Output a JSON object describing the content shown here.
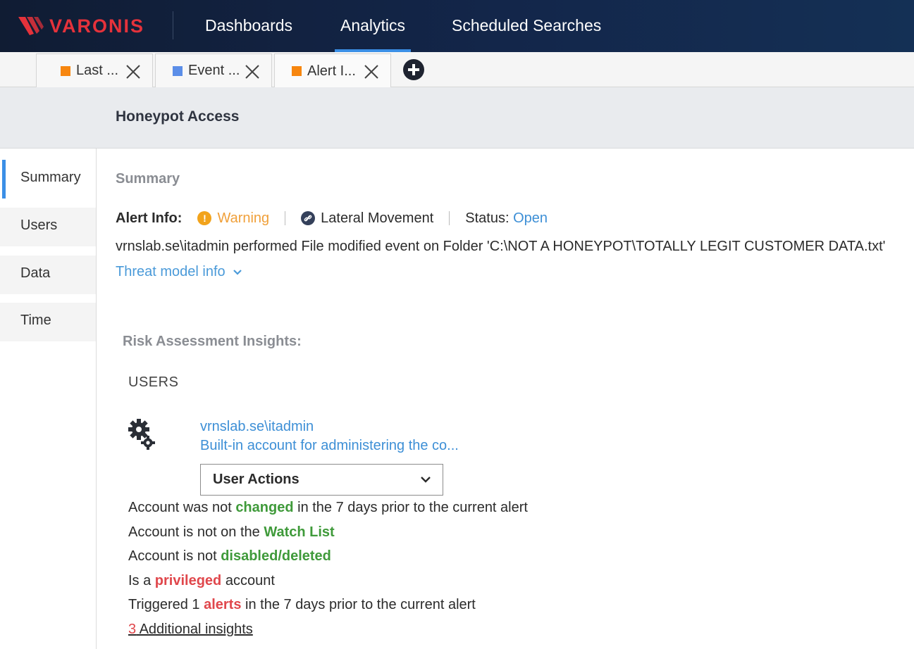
{
  "app": {
    "logo_text": "VARONIS",
    "brand_color": "#e5323b",
    "nav": [
      {
        "label": "Dashboards",
        "active": false
      },
      {
        "label": "Analytics",
        "active": true
      },
      {
        "label": "Scheduled Searches",
        "active": false
      }
    ]
  },
  "tabs": [
    {
      "label": "Last ...",
      "color": "#f7860f"
    },
    {
      "label": "Event ...",
      "color": "#5b8ee8"
    },
    {
      "label": "Alert I...",
      "color": "#f7860f",
      "active": true
    }
  ],
  "page_title": "Honeypot Access",
  "sidebar": {
    "items": [
      {
        "label": "Summary",
        "active": true
      },
      {
        "label": "Users"
      },
      {
        "label": "Data"
      },
      {
        "label": "Time"
      }
    ]
  },
  "summary": {
    "section_title": "Summary",
    "alert_info_label": "Alert Info:",
    "severity": "Warning",
    "severity_icon": "warning-icon",
    "category": "Lateral Movement",
    "category_icon": "link-icon",
    "status_label": "Status:",
    "status_value": "Open",
    "description": "vrnslab.se\\itadmin performed File modified event on Folder 'C:\\NOT A HONEYPOT\\TOTALLY LEGIT CUSTOMER DATA.txt'",
    "threat_model_link": "Threat model info"
  },
  "risk": {
    "title": "Risk Assessment Insights:",
    "users_heading": "USERS",
    "user": {
      "icon": "gear-icon",
      "name": "vrnslab.se\\itadmin",
      "description": "Built-in account for administering the co..."
    },
    "actions_dropdown": "User Actions",
    "insights": [
      {
        "pre": "Account was not ",
        "hl": "changed",
        "post": " in the 7 days prior to the current alert",
        "tone": "good"
      },
      {
        "pre": "Account is not on the ",
        "hl": "Watch List",
        "post": "",
        "tone": "good"
      },
      {
        "pre": "Account is not ",
        "hl": "disabled/deleted",
        "post": "",
        "tone": "good"
      },
      {
        "pre": "Is a ",
        "hl": "privileged",
        "post": " account",
        "tone": "bad"
      },
      {
        "pre": "Triggered 1 ",
        "hl": "alerts",
        "post": " in the 7 days prior to the current alert",
        "tone": "bad"
      }
    ],
    "additional_count": "3",
    "additional_label": " Additional insights"
  }
}
